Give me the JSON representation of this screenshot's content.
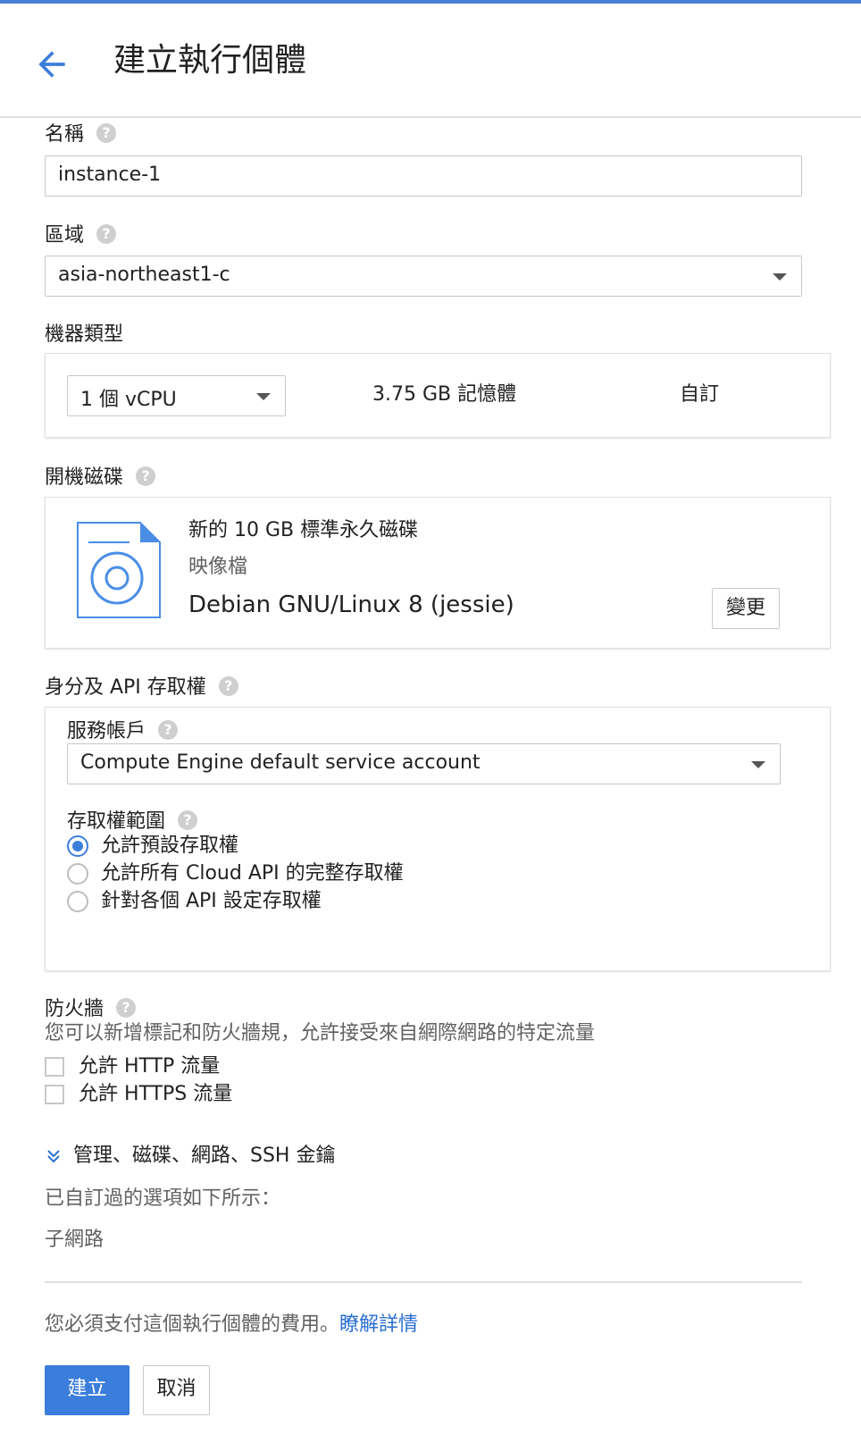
{
  "header": {
    "title": "建立執行個體"
  },
  "name_section": {
    "label": "名稱",
    "value": "instance-1"
  },
  "zone_section": {
    "label": "區域",
    "value": "asia-northeast1-c"
  },
  "machine_type": {
    "label": "機器類型",
    "cpu_value": "1 個 vCPU",
    "memory": "3.75 GB 記憶體",
    "customize_link": "自訂"
  },
  "boot_disk": {
    "label": "開機磁碟",
    "title": "新的 10 GB 標準永久磁碟",
    "image_label": "映像檔",
    "image_value": "Debian GNU/Linux 8 (jessie)",
    "change_button": "變更"
  },
  "identity": {
    "label": "身分及 API 存取權",
    "service_account_label": "服務帳戶",
    "service_account_value": "Compute Engine default service account",
    "scope_label": "存取權範圍",
    "scope_options": [
      {
        "label": "允許預設存取權",
        "selected": true
      },
      {
        "label": "允許所有 Cloud API 的完整存取權",
        "selected": false
      },
      {
        "label": "針對各個 API 設定存取權",
        "selected": false
      }
    ]
  },
  "firewall": {
    "label": "防火牆",
    "description": "您可以新增標記和防火牆規，允許接受來自網際網路的特定流量",
    "options": [
      {
        "label": "允許 HTTP 流量",
        "checked": false
      },
      {
        "label": "允許 HTTPS 流量",
        "checked": false
      }
    ]
  },
  "advanced": {
    "expand_link": "管理、磁碟、網路、SSH 金鑰",
    "customized_note": "已自訂過的選項如下所示：",
    "customized_item": "子網路"
  },
  "billing": {
    "text": "您必須支付這個執行個體的費用。",
    "learn_more": "瞭解詳情"
  },
  "actions": {
    "create": "建立",
    "cancel": "取消"
  },
  "colors": {
    "accent": "#2a6fd1",
    "primary_button": "#3b7ddb",
    "top_bar": "#4a7fd6"
  }
}
